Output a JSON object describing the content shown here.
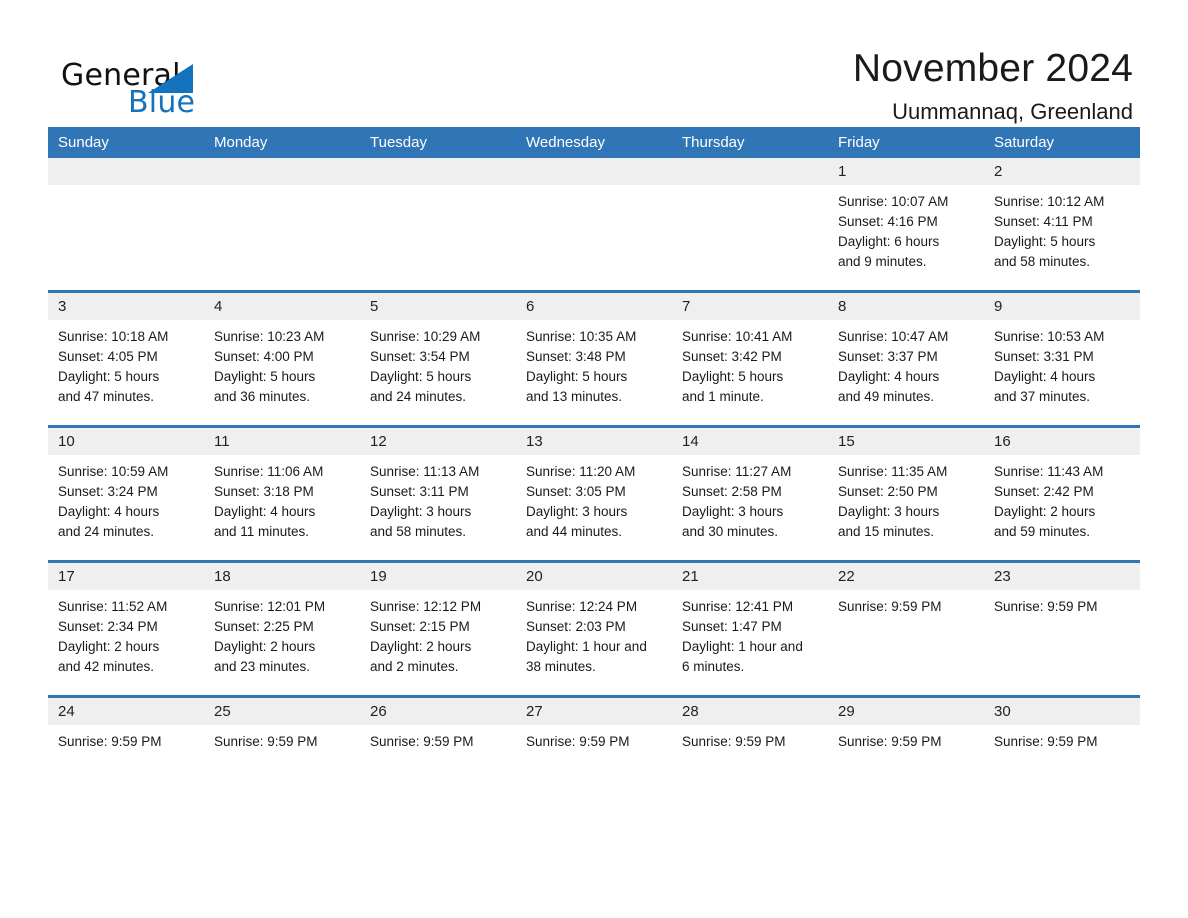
{
  "logo": {
    "text_general": "General",
    "text_blue": "Blue",
    "brand_color": "#1573be"
  },
  "header": {
    "title": "November 2024",
    "subtitle": "Uummannaq, Greenland",
    "accent_color": "#3075b5",
    "day_band_color": "#efefef"
  },
  "weekdays": [
    "Sunday",
    "Monday",
    "Tuesday",
    "Wednesday",
    "Thursday",
    "Friday",
    "Saturday"
  ],
  "weeks": [
    [
      {
        "day": "",
        "lines": []
      },
      {
        "day": "",
        "lines": []
      },
      {
        "day": "",
        "lines": []
      },
      {
        "day": "",
        "lines": []
      },
      {
        "day": "",
        "lines": []
      },
      {
        "day": "1",
        "lines": [
          "Sunrise: 10:07 AM",
          "Sunset: 4:16 PM",
          "Daylight: 6 hours",
          "and 9 minutes."
        ]
      },
      {
        "day": "2",
        "lines": [
          "Sunrise: 10:12 AM",
          "Sunset: 4:11 PM",
          "Daylight: 5 hours",
          "and 58 minutes."
        ]
      }
    ],
    [
      {
        "day": "3",
        "lines": [
          "Sunrise: 10:18 AM",
          "Sunset: 4:05 PM",
          "Daylight: 5 hours",
          "and 47 minutes."
        ]
      },
      {
        "day": "4",
        "lines": [
          "Sunrise: 10:23 AM",
          "Sunset: 4:00 PM",
          "Daylight: 5 hours",
          "and 36 minutes."
        ]
      },
      {
        "day": "5",
        "lines": [
          "Sunrise: 10:29 AM",
          "Sunset: 3:54 PM",
          "Daylight: 5 hours",
          "and 24 minutes."
        ]
      },
      {
        "day": "6",
        "lines": [
          "Sunrise: 10:35 AM",
          "Sunset: 3:48 PM",
          "Daylight: 5 hours",
          "and 13 minutes."
        ]
      },
      {
        "day": "7",
        "lines": [
          "Sunrise: 10:41 AM",
          "Sunset: 3:42 PM",
          "Daylight: 5 hours",
          "and 1 minute."
        ]
      },
      {
        "day": "8",
        "lines": [
          "Sunrise: 10:47 AM",
          "Sunset: 3:37 PM",
          "Daylight: 4 hours",
          "and 49 minutes."
        ]
      },
      {
        "day": "9",
        "lines": [
          "Sunrise: 10:53 AM",
          "Sunset: 3:31 PM",
          "Daylight: 4 hours",
          "and 37 minutes."
        ]
      }
    ],
    [
      {
        "day": "10",
        "lines": [
          "Sunrise: 10:59 AM",
          "Sunset: 3:24 PM",
          "Daylight: 4 hours",
          "and 24 minutes."
        ]
      },
      {
        "day": "11",
        "lines": [
          "Sunrise: 11:06 AM",
          "Sunset: 3:18 PM",
          "Daylight: 4 hours",
          "and 11 minutes."
        ]
      },
      {
        "day": "12",
        "lines": [
          "Sunrise: 11:13 AM",
          "Sunset: 3:11 PM",
          "Daylight: 3 hours",
          "and 58 minutes."
        ]
      },
      {
        "day": "13",
        "lines": [
          "Sunrise: 11:20 AM",
          "Sunset: 3:05 PM",
          "Daylight: 3 hours",
          "and 44 minutes."
        ]
      },
      {
        "day": "14",
        "lines": [
          "Sunrise: 11:27 AM",
          "Sunset: 2:58 PM",
          "Daylight: 3 hours",
          "and 30 minutes."
        ]
      },
      {
        "day": "15",
        "lines": [
          "Sunrise: 11:35 AM",
          "Sunset: 2:50 PM",
          "Daylight: 3 hours",
          "and 15 minutes."
        ]
      },
      {
        "day": "16",
        "lines": [
          "Sunrise: 11:43 AM",
          "Sunset: 2:42 PM",
          "Daylight: 2 hours",
          "and 59 minutes."
        ]
      }
    ],
    [
      {
        "day": "17",
        "lines": [
          "Sunrise: 11:52 AM",
          "Sunset: 2:34 PM",
          "Daylight: 2 hours",
          "and 42 minutes."
        ]
      },
      {
        "day": "18",
        "lines": [
          "Sunrise: 12:01 PM",
          "Sunset: 2:25 PM",
          "Daylight: 2 hours",
          "and 23 minutes."
        ]
      },
      {
        "day": "19",
        "lines": [
          "Sunrise: 12:12 PM",
          "Sunset: 2:15 PM",
          "Daylight: 2 hours",
          "and 2 minutes."
        ]
      },
      {
        "day": "20",
        "lines": [
          "Sunrise: 12:24 PM",
          "Sunset: 2:03 PM",
          "Daylight: 1 hour and",
          "38 minutes."
        ]
      },
      {
        "day": "21",
        "lines": [
          "Sunrise: 12:41 PM",
          "Sunset: 1:47 PM",
          "Daylight: 1 hour and",
          "6 minutes."
        ]
      },
      {
        "day": "22",
        "lines": [
          "Sunrise: 9:59 PM"
        ]
      },
      {
        "day": "23",
        "lines": [
          "Sunrise: 9:59 PM"
        ]
      }
    ],
    [
      {
        "day": "24",
        "lines": [
          "Sunrise: 9:59 PM"
        ]
      },
      {
        "day": "25",
        "lines": [
          "Sunrise: 9:59 PM"
        ]
      },
      {
        "day": "26",
        "lines": [
          "Sunrise: 9:59 PM"
        ]
      },
      {
        "day": "27",
        "lines": [
          "Sunrise: 9:59 PM"
        ]
      },
      {
        "day": "28",
        "lines": [
          "Sunrise: 9:59 PM"
        ]
      },
      {
        "day": "29",
        "lines": [
          "Sunrise: 9:59 PM"
        ]
      },
      {
        "day": "30",
        "lines": [
          "Sunrise: 9:59 PM"
        ]
      }
    ]
  ]
}
